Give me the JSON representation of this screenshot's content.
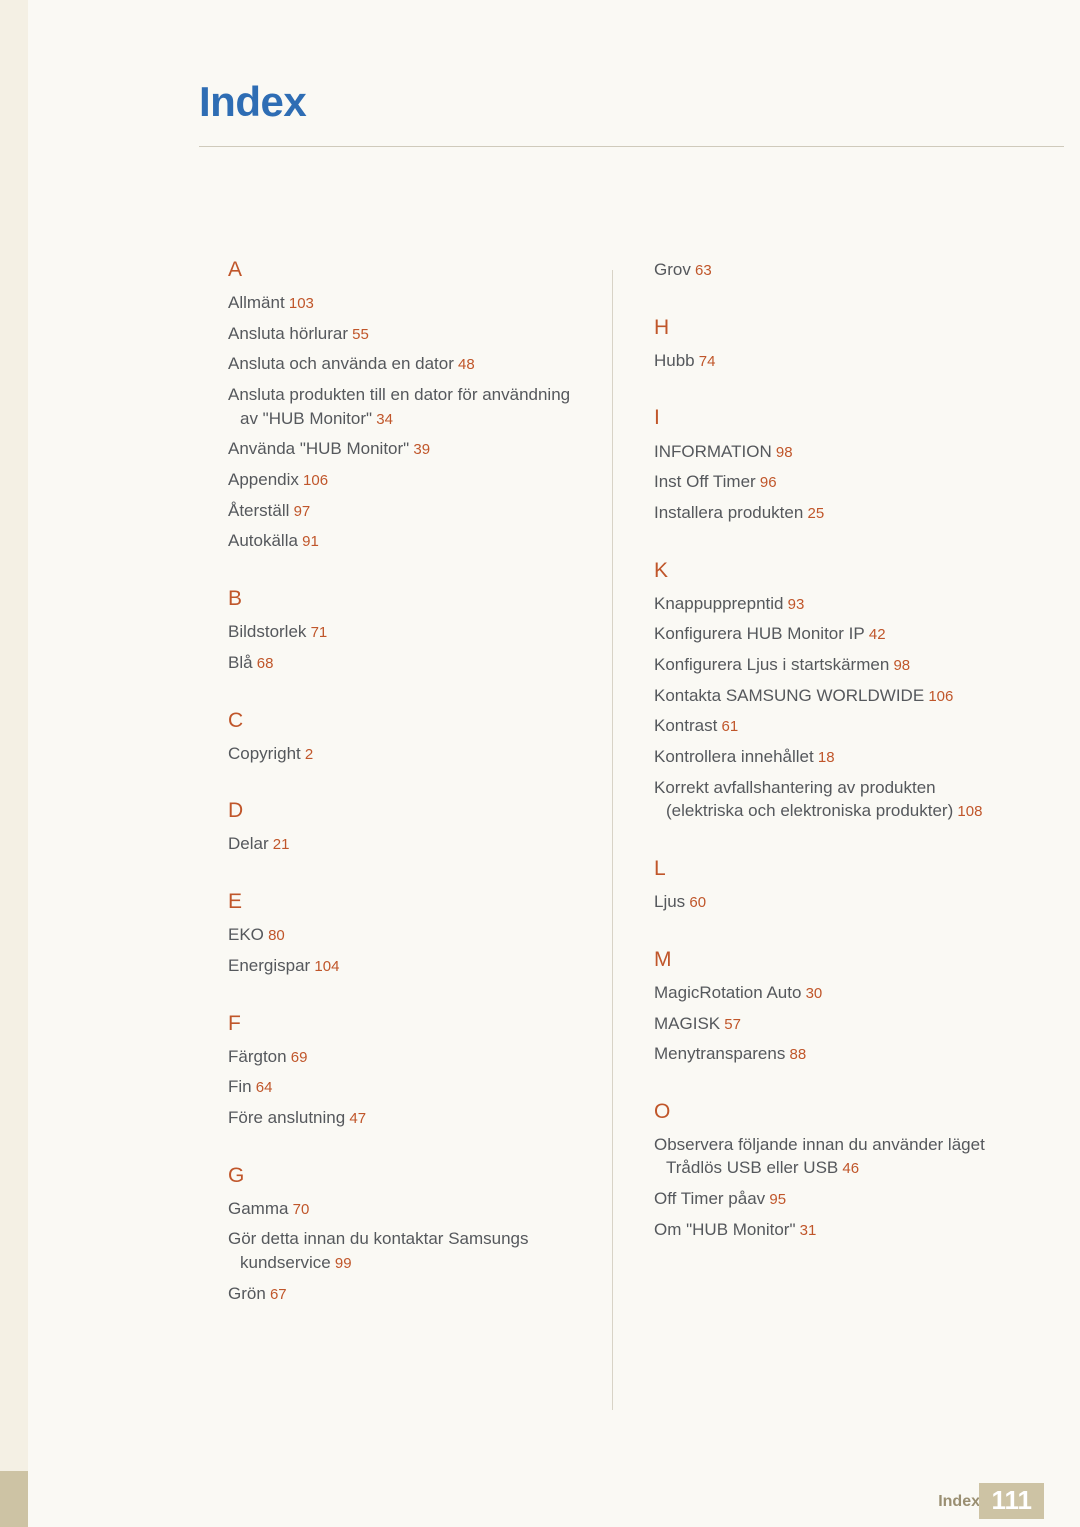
{
  "page": {
    "title": "Index",
    "footer_label": "Index",
    "footer_page": "111"
  },
  "colors": {
    "title": "#2e6db4",
    "letter": "#c0562a",
    "page_number": "#c0562a",
    "entry_text": "#55585c",
    "footer_band": "#cdc3a4"
  },
  "columns": [
    {
      "id": "left",
      "groups": [
        {
          "letter": "A",
          "entries": [
            {
              "text": "Allmänt",
              "page": "103"
            },
            {
              "text": "Ansluta hörlurar",
              "page": "55"
            },
            {
              "text": "Ansluta och använda en dator",
              "page": "48"
            },
            {
              "text": "Ansluta produkten till en dator för användning",
              "cont": "av \"HUB Monitor\"",
              "page": "34"
            },
            {
              "text": "Använda \"HUB Monitor\"",
              "page": "39"
            },
            {
              "text": "Appendix",
              "page": "106"
            },
            {
              "text": "Återställ",
              "page": "97"
            },
            {
              "text": "Autokälla",
              "page": "91"
            }
          ]
        },
        {
          "letter": "B",
          "entries": [
            {
              "text": "Bildstorlek",
              "page": "71"
            },
            {
              "text": "Blå",
              "page": "68"
            }
          ]
        },
        {
          "letter": "C",
          "entries": [
            {
              "text": "Copyright",
              "page": "2"
            }
          ]
        },
        {
          "letter": "D",
          "entries": [
            {
              "text": "Delar",
              "page": "21"
            }
          ]
        },
        {
          "letter": "E",
          "entries": [
            {
              "text": "EKO",
              "page": "80"
            },
            {
              "text": "Energispar",
              "page": "104"
            }
          ]
        },
        {
          "letter": "F",
          "entries": [
            {
              "text": "Färgton",
              "page": "69"
            },
            {
              "text": "Fin",
              "page": "64"
            },
            {
              "text": "Före anslutning",
              "page": "47"
            }
          ]
        },
        {
          "letter": "G",
          "entries": [
            {
              "text": "Gamma",
              "page": "70"
            },
            {
              "text": "Gör detta innan du kontaktar Samsungs",
              "cont": "kundservice",
              "page": "99"
            },
            {
              "text": "Grön",
              "page": "67"
            }
          ]
        }
      ]
    },
    {
      "id": "right",
      "groups": [
        {
          "letter": "",
          "entries": [
            {
              "text": "Grov",
              "page": "63"
            }
          ]
        },
        {
          "letter": "H",
          "entries": [
            {
              "text": "Hubb",
              "page": "74"
            }
          ]
        },
        {
          "letter": "I",
          "entries": [
            {
              "text": "INFORMATION",
              "page": "98"
            },
            {
              "text": "Inst Off Timer",
              "page": "96"
            },
            {
              "text": "Installera produkten",
              "page": "25"
            }
          ]
        },
        {
          "letter": "K",
          "entries": [
            {
              "text": "Knappupprepntid",
              "page": "93"
            },
            {
              "text": "Konfigurera HUB Monitor IP",
              "page": "42"
            },
            {
              "text": "Konfigurera Ljus i startskärmen",
              "page": "98"
            },
            {
              "text": "Kontakta SAMSUNG WORLDWIDE",
              "page": "106"
            },
            {
              "text": "Kontrast",
              "page": "61"
            },
            {
              "text": "Kontrollera innehållet",
              "page": "18"
            },
            {
              "text": "Korrekt avfallshantering av produkten",
              "cont": "(elektriska och elektroniska produkter)",
              "page": "108"
            }
          ]
        },
        {
          "letter": "L",
          "entries": [
            {
              "text": "Ljus",
              "page": "60"
            }
          ]
        },
        {
          "letter": "M",
          "entries": [
            {
              "text": "MagicRotation Auto",
              "page": "30"
            },
            {
              "text": "MAGISK",
              "page": "57"
            },
            {
              "text": "Menytransparens",
              "page": "88"
            }
          ]
        },
        {
          "letter": "O",
          "entries": [
            {
              "text": "Observera följande innan du använder läget",
              "cont": "Trådlös USB eller USB",
              "page": "46"
            },
            {
              "text": "Off Timer påav",
              "page": "95"
            },
            {
              "text": "Om \"HUB Monitor\"",
              "page": "31"
            }
          ]
        }
      ]
    }
  ]
}
